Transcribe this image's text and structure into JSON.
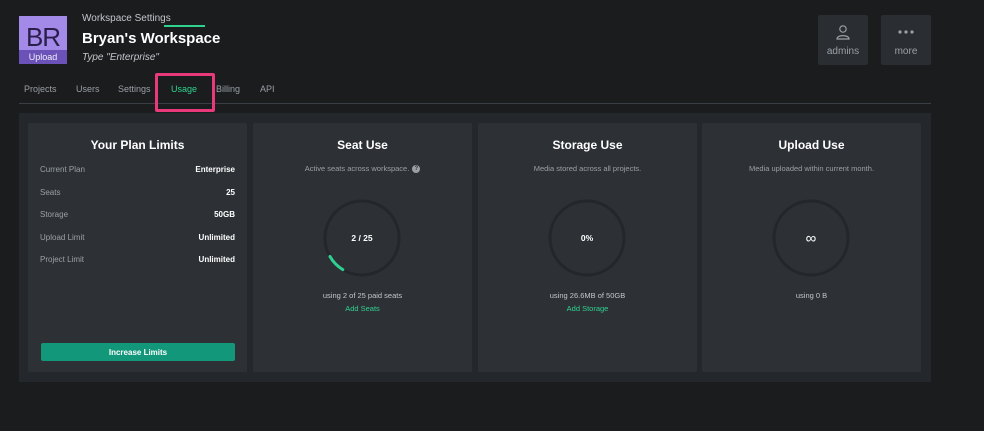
{
  "header": {
    "avatar_initials": "BR",
    "avatar_upload_label": "Upload",
    "overline": "Workspace Settings",
    "title": "Bryan's Workspace",
    "type_label": "Type \"Enterprise\"",
    "buttons": [
      {
        "label": "admins",
        "icon": "user-icon"
      },
      {
        "label": "more",
        "icon": "more-dots-icon"
      }
    ]
  },
  "tabs": [
    {
      "label": "Projects",
      "active": false
    },
    {
      "label": "Users",
      "active": false
    },
    {
      "label": "Settings",
      "active": false
    },
    {
      "label": "Usage",
      "active": true
    },
    {
      "label": "Billing",
      "active": false
    },
    {
      "label": "API",
      "active": false
    }
  ],
  "plan_limits": {
    "title": "Your Plan Limits",
    "rows": [
      {
        "label": "Current Plan",
        "value": "Enterprise"
      },
      {
        "label": "Seats",
        "value": "25"
      },
      {
        "label": "Storage",
        "value": "50GB"
      },
      {
        "label": "Upload Limit",
        "value": "Unlimited"
      },
      {
        "label": "Project Limit",
        "value": "Unlimited"
      }
    ],
    "button_label": "Increase Limits"
  },
  "seat_use": {
    "title": "Seat Use",
    "subtitle": "Active seats across workspace.",
    "gauge_label": "2 / 25",
    "fraction": 0.08,
    "usage": "using 2 of 25 paid seats",
    "link": "Add Seats"
  },
  "storage_use": {
    "title": "Storage Use",
    "subtitle": "Media stored across all projects.",
    "gauge_label": "0%",
    "fraction": 0.0,
    "usage": "using 26.6MB of 50GB",
    "link": "Add Storage"
  },
  "upload_use": {
    "title": "Upload Use",
    "subtitle": "Media uploaded within current month.",
    "gauge_label": "∞",
    "usage": "using 0 B"
  },
  "colors": {
    "accent": "#2fd18f",
    "button": "#12977a",
    "highlight": "#e8397a",
    "avatar": "#a38ae8"
  }
}
